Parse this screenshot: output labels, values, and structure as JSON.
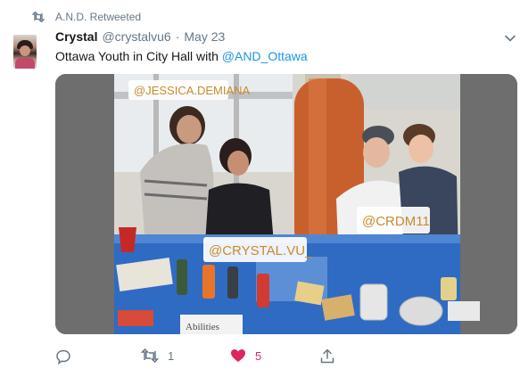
{
  "retweet": {
    "text": "A.N.D. Retweeted",
    "icon": "retweet-icon"
  },
  "tweet": {
    "author_name": "Crystal",
    "author_handle": "@crystalvu6",
    "separator": "·",
    "date": "May 23",
    "text_prefix": "Ottawa Youth in City Hall with ",
    "mention": "@AND_Ottawa",
    "menu_icon": "chevron-down-icon"
  },
  "media": {
    "overlay_labels": {
      "tag1": "@JESSICA.DEMIANA",
      "tag2": "@CRYSTAL.VU_",
      "tag3": "@CRDM11"
    },
    "booth_sign": "Abilities"
  },
  "actions": {
    "reply_icon": "reply-icon",
    "retweet_count": "1",
    "retweet_icon": "retweet-icon",
    "like_count": "5",
    "like_icon": "heart-icon",
    "share_icon": "share-icon"
  },
  "colors": {
    "link": "#1b95e0",
    "secondary_text": "#657786",
    "like": "#e0245e"
  }
}
